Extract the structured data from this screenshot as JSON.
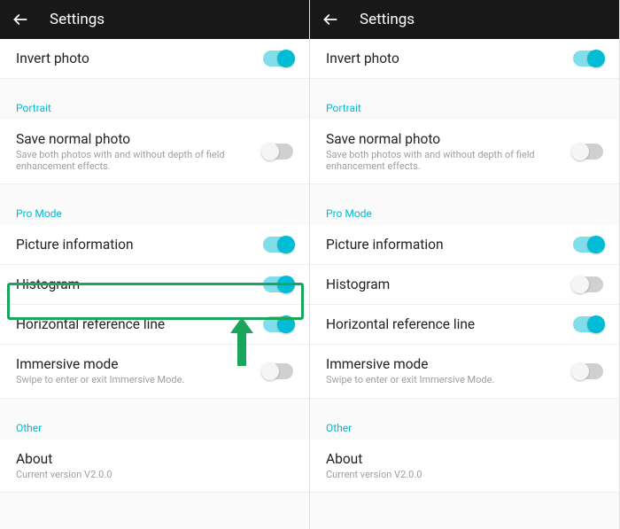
{
  "header": {
    "title": "Settings"
  },
  "left": {
    "invert": {
      "label": "Invert photo",
      "on": true
    },
    "portrait_section": "Portrait",
    "save_normal": {
      "label": "Save normal photo",
      "sub": "Save both photos with and without depth of field enhancement effects.",
      "on": false
    },
    "promode_section": "Pro Mode",
    "picture_info": {
      "label": "Picture information",
      "on": true
    },
    "histogram": {
      "label": "Histogram",
      "on": true
    },
    "horizontal_ref": {
      "label": "Horizontal reference line",
      "on": true
    },
    "immersive": {
      "label": "Immersive mode",
      "sub": "Swipe to enter or exit Immersive Mode.",
      "on": false
    },
    "other_section": "Other",
    "about": {
      "label": "About",
      "sub": "Current version V2.0.0"
    }
  },
  "right": {
    "invert": {
      "label": "Invert photo",
      "on": true
    },
    "portrait_section": "Portrait",
    "save_normal": {
      "label": "Save normal photo",
      "sub": "Save both photos with and without depth of field enhancement effects.",
      "on": false
    },
    "promode_section": "Pro Mode",
    "picture_info": {
      "label": "Picture information",
      "on": true
    },
    "histogram": {
      "label": "Histogram",
      "on": false
    },
    "horizontal_ref": {
      "label": "Horizontal reference line",
      "on": true
    },
    "immersive": {
      "label": "Immersive mode",
      "sub": "Swipe to enter or exit Immersive Mode.",
      "on": false
    },
    "other_section": "Other",
    "about": {
      "label": "About",
      "sub": "Current version V2.0.0"
    }
  }
}
